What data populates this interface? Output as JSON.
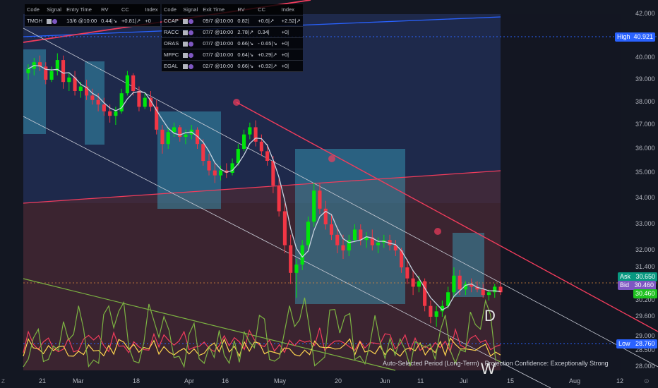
{
  "chart_data": {
    "type": "candlestick",
    "x_labels": [
      "21",
      "Mar",
      "18",
      "Apr",
      "16",
      "May",
      "20",
      "Jun",
      "11",
      "Jul",
      "15",
      "Aug",
      "12"
    ],
    "y_ticks": [
      "42.000",
      "40.000",
      "39.000",
      "38.000",
      "37.000",
      "36.000",
      "35.000",
      "34.000",
      "33.000",
      "32.000",
      "31.400",
      "30.200",
      "29.600",
      "29.000",
      "28.500",
      "28.000"
    ],
    "price_labels": {
      "high_label": "High",
      "high_value": "40.921",
      "ask_label": "Ask",
      "ask_value": "30.650",
      "bid_label": "Bid",
      "bid_value": "30.460",
      "last_value": "30.460",
      "low_label": "Low",
      "low_value": "28.760"
    },
    "candles": [
      [
        39.3,
        39.7,
        39.0,
        39.5
      ],
      [
        39.5,
        40.0,
        39.2,
        39.8
      ],
      [
        39.8,
        40.1,
        39.4,
        39.6
      ],
      [
        39.6,
        39.8,
        38.8,
        39.0
      ],
      [
        39.0,
        39.6,
        38.9,
        39.4
      ],
      [
        39.4,
        40.2,
        39.2,
        39.9
      ],
      [
        39.9,
        40.1,
        38.6,
        38.9
      ],
      [
        38.9,
        39.3,
        38.5,
        39.1
      ],
      [
        39.1,
        39.4,
        38.3,
        38.5
      ],
      [
        38.5,
        38.9,
        38.2,
        38.7
      ],
      [
        38.7,
        39.0,
        38.1,
        38.3
      ],
      [
        38.3,
        38.6,
        37.9,
        38.1
      ],
      [
        38.1,
        38.4,
        37.6,
        37.9
      ],
      [
        37.9,
        38.2,
        37.4,
        37.6
      ],
      [
        37.6,
        37.9,
        37.1,
        37.4
      ],
      [
        37.4,
        37.8,
        37.0,
        37.6
      ],
      [
        37.6,
        38.6,
        37.5,
        38.4
      ],
      [
        38.4,
        39.4,
        38.3,
        39.2
      ],
      [
        39.2,
        39.3,
        38.3,
        38.5
      ],
      [
        38.5,
        38.7,
        37.6,
        37.8
      ],
      [
        37.8,
        38.4,
        37.7,
        38.2
      ],
      [
        38.2,
        38.5,
        37.6,
        37.8
      ],
      [
        37.8,
        38.1,
        36.6,
        36.8
      ],
      [
        36.8,
        37.0,
        35.8,
        36.2
      ],
      [
        36.2,
        36.9,
        36.0,
        36.7
      ],
      [
        36.7,
        37.1,
        36.5,
        36.9
      ],
      [
        36.9,
        37.0,
        36.3,
        36.5
      ],
      [
        36.5,
        36.8,
        36.2,
        36.6
      ],
      [
        36.6,
        37.0,
        36.4,
        36.8
      ],
      [
        36.8,
        36.9,
        36.0,
        36.2
      ],
      [
        36.2,
        36.4,
        35.3,
        35.5
      ],
      [
        35.5,
        35.8,
        34.9,
        35.1
      ],
      [
        35.1,
        35.4,
        34.6,
        34.9
      ],
      [
        34.9,
        35.3,
        34.7,
        35.1
      ],
      [
        35.1,
        35.4,
        34.8,
        35.0
      ],
      [
        35.0,
        35.6,
        34.9,
        35.4
      ],
      [
        35.4,
        36.2,
        35.3,
        36.0
      ],
      [
        36.0,
        36.8,
        35.9,
        36.6
      ],
      [
        36.6,
        37.1,
        36.4,
        36.9
      ],
      [
        36.9,
        37.2,
        36.1,
        36.3
      ],
      [
        36.3,
        36.6,
        35.7,
        35.9
      ],
      [
        35.9,
        36.2,
        35.3,
        35.5
      ],
      [
        35.5,
        35.7,
        34.2,
        34.5
      ],
      [
        34.5,
        34.8,
        33.3,
        33.5
      ],
      [
        33.5,
        33.8,
        31.9,
        32.2
      ],
      [
        32.2,
        32.6,
        30.8,
        31.2
      ],
      [
        31.2,
        31.7,
        30.3,
        31.5
      ],
      [
        31.5,
        32.4,
        31.3,
        32.2
      ],
      [
        32.2,
        33.3,
        32.0,
        33.1
      ],
      [
        33.1,
        34.6,
        32.9,
        34.3
      ],
      [
        34.3,
        34.6,
        33.4,
        33.6
      ],
      [
        33.6,
        33.9,
        32.8,
        33.0
      ],
      [
        33.0,
        33.4,
        32.4,
        32.6
      ],
      [
        32.6,
        32.9,
        31.9,
        32.2
      ],
      [
        32.2,
        32.6,
        31.7,
        32.0
      ],
      [
        32.0,
        32.6,
        31.8,
        32.4
      ],
      [
        32.4,
        33.0,
        32.3,
        32.8
      ],
      [
        32.8,
        33.0,
        32.2,
        32.4
      ],
      [
        32.4,
        32.7,
        32.1,
        32.5
      ],
      [
        32.5,
        32.8,
        32.0,
        32.2
      ],
      [
        32.2,
        32.5,
        31.9,
        32.3
      ],
      [
        32.3,
        32.6,
        32.1,
        32.4
      ],
      [
        32.4,
        32.6,
        32.0,
        32.2
      ],
      [
        32.2,
        32.4,
        31.8,
        32.0
      ],
      [
        32.0,
        32.1,
        31.2,
        31.4
      ],
      [
        31.4,
        31.7,
        30.8,
        31.0
      ],
      [
        31.0,
        31.3,
        30.4,
        30.7
      ],
      [
        30.7,
        31.1,
        30.5,
        30.9
      ],
      [
        30.9,
        31.0,
        29.8,
        30.0
      ],
      [
        30.0,
        30.2,
        29.4,
        29.6
      ],
      [
        29.6,
        30.0,
        29.3,
        29.8
      ],
      [
        29.8,
        30.2,
        29.6,
        30.0
      ],
      [
        30.0,
        30.7,
        29.9,
        30.5
      ],
      [
        30.5,
        31.4,
        30.3,
        31.1
      ],
      [
        31.1,
        31.3,
        30.4,
        30.6
      ],
      [
        30.6,
        30.9,
        30.4,
        30.8
      ],
      [
        30.8,
        31.0,
        30.5,
        30.7
      ],
      [
        30.7,
        30.9,
        30.5,
        30.6
      ],
      [
        30.6,
        30.8,
        30.3,
        30.4
      ],
      [
        30.4,
        30.6,
        30.2,
        30.5
      ],
      [
        30.5,
        30.8,
        30.3,
        30.7
      ],
      [
        30.7,
        30.9,
        30.4,
        30.5
      ]
    ],
    "trade_tables": [
      {
        "header": [
          "Code",
          "Signal",
          "Entry Time",
          "RV",
          "CC",
          "Index"
        ],
        "rows": [
          [
            "TMGH",
            "",
            "13/6 @10:00",
            "0.44|↘",
            "+0.81|↗",
            "+0"
          ]
        ]
      },
      {
        "header": [
          "Code",
          "Signal",
          "Exit Time",
          "RV",
          "CC",
          "Index"
        ],
        "rows": [
          [
            "CCAP",
            "",
            "09/7 @10:00",
            "0.82|",
            "+0.6|↗",
            "+2.52|↗"
          ],
          [
            "RACC",
            "",
            "07/7 @10:00",
            "2.78|↗",
            "0.34|",
            "+0|"
          ],
          [
            "ORAS",
            "",
            "07/7 @10:00",
            "0.66|↘",
            "- 0.65|↘",
            "+0|"
          ],
          [
            "MFPC",
            "",
            "07/7 @10:00",
            "0.64|↘",
            "+0.29|↗",
            "+0|"
          ],
          [
            "EGAL",
            "",
            "02/7 @10:00",
            "0.66|↘",
            "+0.92|↗",
            "+0|"
          ]
        ]
      }
    ],
    "pattern_labels": {
      "d": "D",
      "w": "W"
    },
    "status_text": "Auto-Selected Period (Long-Term) · Projection Confidence: Exceptionally Strong",
    "colors": {
      "up": "#00e60b",
      "down": "#f23645",
      "bg": "#131722",
      "red_line": "#f23c5c",
      "blue_line": "#2962ff"
    }
  }
}
